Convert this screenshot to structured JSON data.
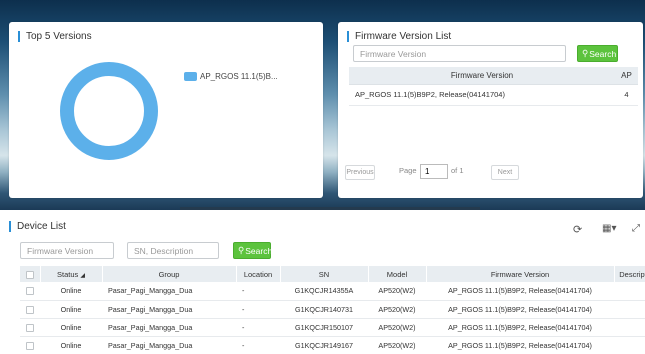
{
  "top5": {
    "title": "Top 5 Versions",
    "legend": "AP_RGOS 11.1(5)B...",
    "accent": "#5cb0ea"
  },
  "firmware_list": {
    "title": "Firmware Version List",
    "search_placeholder": "Firmware Version",
    "search_label": "Search",
    "columns": [
      "Firmware Version",
      "AP"
    ],
    "rows": [
      {
        "version": "AP_RGOS 11.1(5)B9P2, Release(04141704)",
        "ap": "4"
      }
    ],
    "pager": {
      "previous": "Previous",
      "page_label": "Page",
      "page_value": "1",
      "of_label": "of 1",
      "next": "Next"
    }
  },
  "device_list": {
    "title": "Device List",
    "fw_placeholder": "Firmware Version",
    "sn_placeholder": "SN, Description",
    "search_label": "Search",
    "columns": [
      "Status",
      "Group",
      "Location",
      "SN",
      "Model",
      "Firmware Version",
      "Description"
    ],
    "rows": [
      {
        "status": "Online",
        "group": "Pasar_Pagi_Mangga_Dua",
        "location": "-",
        "sn": "G1KQCJR14355A",
        "model": "AP520(W2)",
        "firmware": "AP_RGOS 11.1(5)B9P2, Release(04141704)",
        "description": ""
      },
      {
        "status": "Online",
        "group": "Pasar_Pagi_Mangga_Dua",
        "location": "-",
        "sn": "G1KQCJR140731",
        "model": "AP520(W2)",
        "firmware": "AP_RGOS 11.1(5)B9P2, Release(04141704)",
        "description": ""
      },
      {
        "status": "Online",
        "group": "Pasar_Pagi_Mangga_Dua",
        "location": "-",
        "sn": "G1KQCJR150107",
        "model": "AP520(W2)",
        "firmware": "AP_RGOS 11.1(5)B9P2, Release(04141704)",
        "description": ""
      },
      {
        "status": "Online",
        "group": "Pasar_Pagi_Mangga_Dua",
        "location": "-",
        "sn": "G1KQCJR149167",
        "model": "AP520(W2)",
        "firmware": "AP_RGOS 11.1(5)B9P2, Release(04141704)",
        "description": ""
      }
    ],
    "icons": [
      "refresh-icon",
      "grid-view-icon",
      "fullscreen-icon"
    ]
  },
  "colors": {
    "search_green": "#5cc33d",
    "title_accent": "#2a8fd6",
    "header_bg": "#e8edf1"
  }
}
